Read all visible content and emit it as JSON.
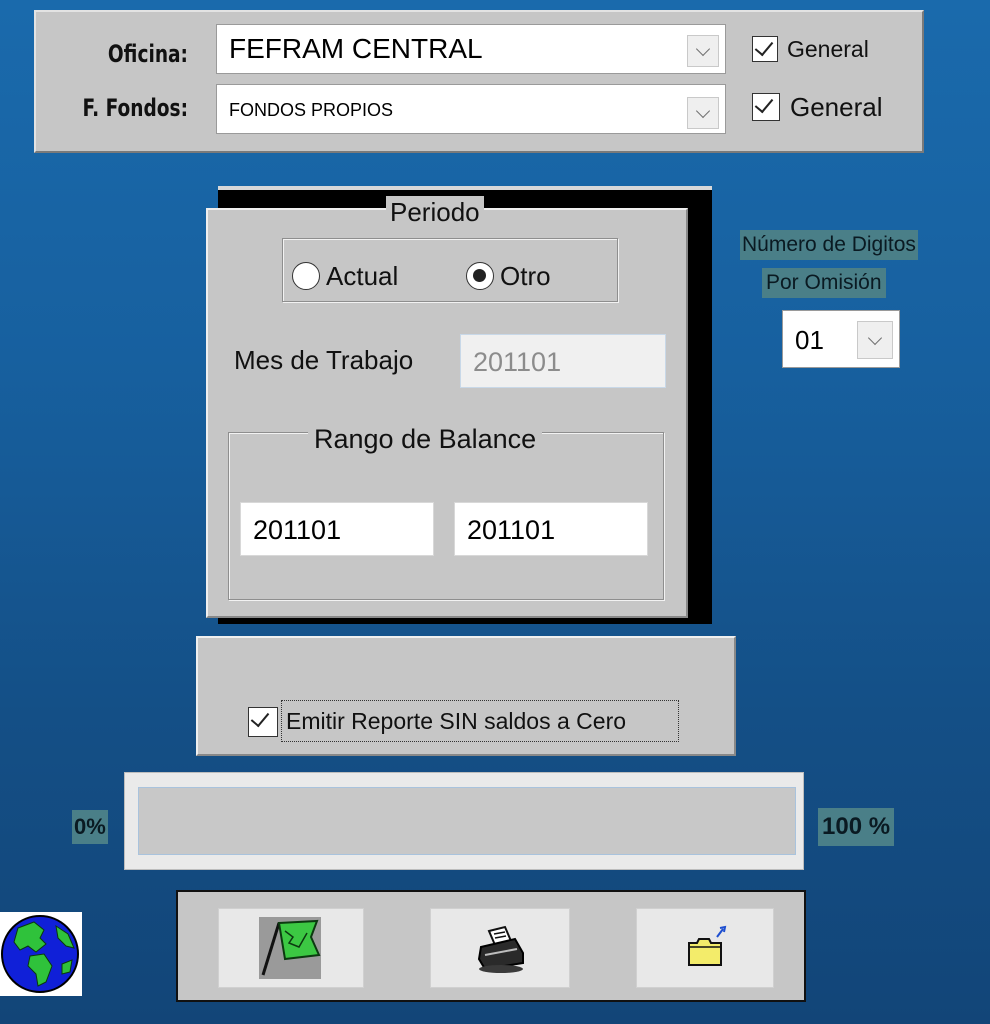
{
  "filters": {
    "oficina": {
      "label": "Oficina:",
      "value": "FEFRAM CENTRAL",
      "general_label": "General",
      "general_checked": true
    },
    "fondos": {
      "label": "F. Fondos:",
      "value": "FONDOS PROPIOS",
      "general_label": "General",
      "general_checked": true
    }
  },
  "periodo": {
    "title": "Periodo",
    "radio_actual": "Actual",
    "radio_otro": "Otro",
    "selected": "Otro",
    "mes_label": "Mes de Trabajo",
    "mes_value": "201101",
    "rango": {
      "title": "Rango de Balance",
      "from": "201101",
      "to": "201101"
    }
  },
  "digits": {
    "line1": "Número de Digitos",
    "line2": "Por Omisión",
    "value": "01"
  },
  "emit": {
    "label": "Emitir Reporte SIN saldos a Cero",
    "checked": true
  },
  "progress": {
    "min_label": "0%",
    "max_label": "100 %",
    "value": 0
  },
  "toolbar": {
    "buttons": [
      {
        "icon": "flag-icon"
      },
      {
        "icon": "printer-icon"
      },
      {
        "icon": "exit-folder-icon"
      }
    ]
  },
  "icons": {
    "globe": "globe-icon"
  },
  "colors": {
    "background": "#1a6aac",
    "panel": "#c6c6c6",
    "label_tag": "#4a7f88"
  }
}
